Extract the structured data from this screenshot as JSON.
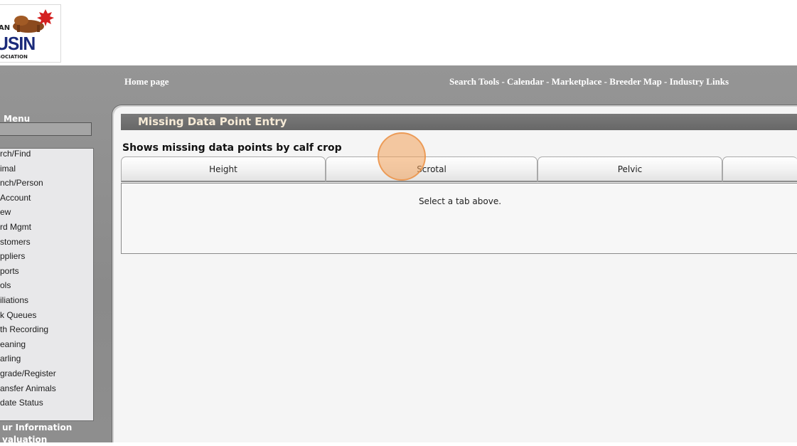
{
  "logo": {
    "line1": "AN",
    "line2": "USIN",
    "line3": "SOCIATION",
    "colors": {
      "leaf": "#d42020",
      "animal": "#8b4a1e",
      "text": "#1a2a7a"
    }
  },
  "nav": {
    "home": "Home page",
    "links": [
      "Search Tools",
      "Calendar",
      "Marketplace",
      "Breeder Map",
      "Industry Links"
    ],
    "separator": " - "
  },
  "menu": {
    "title": "Menu",
    "items": [
      "rch/Find",
      "imal",
      "nch/Person",
      "Account",
      "ew",
      "rd Mgmt",
      "stomers",
      "ppliers",
      "ports",
      "ols",
      "iliations",
      "k Queues",
      "th Recording",
      "eaning",
      "arling",
      "grade/Register",
      "ansfer Animals",
      "date Status"
    ],
    "extra": [
      "ur Information",
      "valuation"
    ]
  },
  "main": {
    "section_title": "Missing Data Point Entry",
    "subtitle": "Shows missing data points by calf crop",
    "tabs": [
      "Height",
      "Scrotal",
      "Pelvic",
      ""
    ],
    "message": "Select a tab above."
  },
  "colors": {
    "shell": "#8c8c8c",
    "section_header": "#727272",
    "section_title": "#f6ead6",
    "cursor": "#f0a05a"
  }
}
